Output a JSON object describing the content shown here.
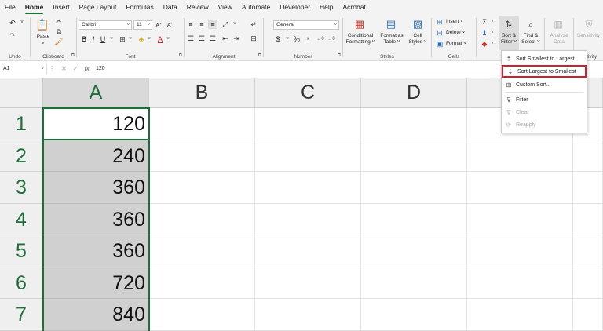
{
  "menu_tabs": [
    "File",
    "Home",
    "Insert",
    "Page Layout",
    "Formulas",
    "Data",
    "Review",
    "View",
    "Automate",
    "Developer",
    "Help",
    "Acrobat"
  ],
  "ribbon": {
    "undo_label": "Undo",
    "clipboard": {
      "paste": "Paste",
      "label": "Clipboard"
    },
    "font": {
      "family": "Calibri",
      "size": "11",
      "bold": "B",
      "italic": "I",
      "underline": "U",
      "label": "Font",
      "grow": "A",
      "shrink": "A",
      "color_letter": "A"
    },
    "alignment": {
      "label": "Alignment"
    },
    "number": {
      "format": "General",
      "percent": "%",
      "label": "Number"
    },
    "styles": {
      "conditional": [
        "Conditional",
        "Formatting ˅"
      ],
      "format_table": [
        "Format as",
        "Table ˅"
      ],
      "cell_styles": [
        "Cell",
        "Styles ˅"
      ],
      "label": "Styles"
    },
    "cells": {
      "insert": "Insert ˅",
      "delete": "Delete ˅",
      "format": "Format ˅",
      "label": "Cells"
    },
    "editing": {
      "sort_filter": [
        "Sort &",
        "Filter ˅"
      ],
      "find_select": [
        "Find &",
        "Select ˅"
      ]
    },
    "analyze": [
      "Analyze",
      "Data"
    ],
    "sensitivity": "Sensitivity",
    "sensitivity_label": "nsitivity"
  },
  "formula_bar": {
    "name_box": "A1",
    "fx": "fx",
    "value": "120"
  },
  "columns": [
    "A",
    "B",
    "C",
    "D"
  ],
  "rows": [
    {
      "num": "1",
      "a": "120"
    },
    {
      "num": "2",
      "a": "240"
    },
    {
      "num": "3",
      "a": "360"
    },
    {
      "num": "4",
      "a": "360"
    },
    {
      "num": "5",
      "a": "360"
    },
    {
      "num": "6",
      "a": "720"
    },
    {
      "num": "7",
      "a": "840"
    }
  ],
  "sort_menu": {
    "items": [
      {
        "label": "Sort Smallest to Largest",
        "enabled": true
      },
      {
        "label": "Sort Largest to Smallest",
        "enabled": true,
        "highlighted": true
      },
      {
        "label": "Custom Sort...",
        "enabled": true
      },
      {
        "label": "Filter",
        "enabled": true
      },
      {
        "label": "Clear",
        "enabled": false
      },
      {
        "label": "Reapply",
        "enabled": false
      }
    ]
  },
  "colors": {
    "accent": "#1e6e3a",
    "highlight": "#d0202f",
    "selection": "#d0d0d0"
  }
}
